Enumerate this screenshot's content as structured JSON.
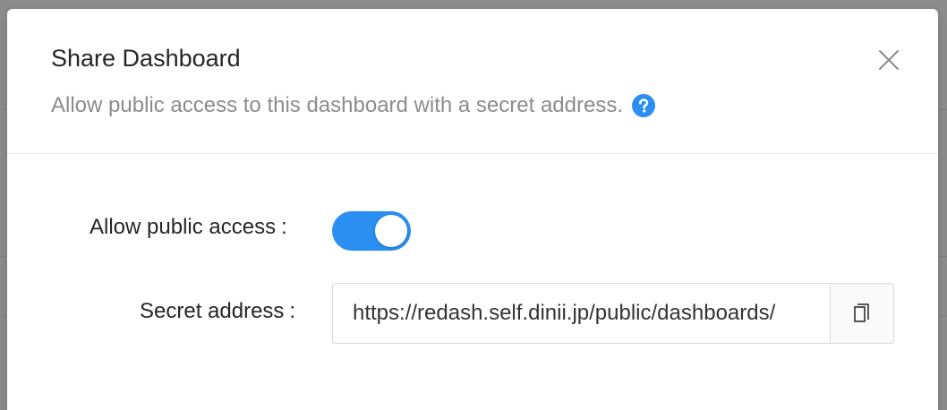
{
  "modal": {
    "title": "Share Dashboard",
    "description": "Allow public access to this dashboard with a secret address.",
    "help_icon": "question-circle-icon",
    "close_icon": "close-icon"
  },
  "form": {
    "public_access": {
      "label": "Allow public access",
      "colon": ":",
      "enabled": true
    },
    "secret_address": {
      "label": "Secret address",
      "colon": ":",
      "value": "https://redash.self.dinii.jp/public/dashboards/",
      "copy_icon": "copy-icon"
    }
  },
  "colors": {
    "accent": "#2a8ff0",
    "title": "#262626",
    "muted": "#8c8c8c",
    "border": "#d9d9d9"
  }
}
